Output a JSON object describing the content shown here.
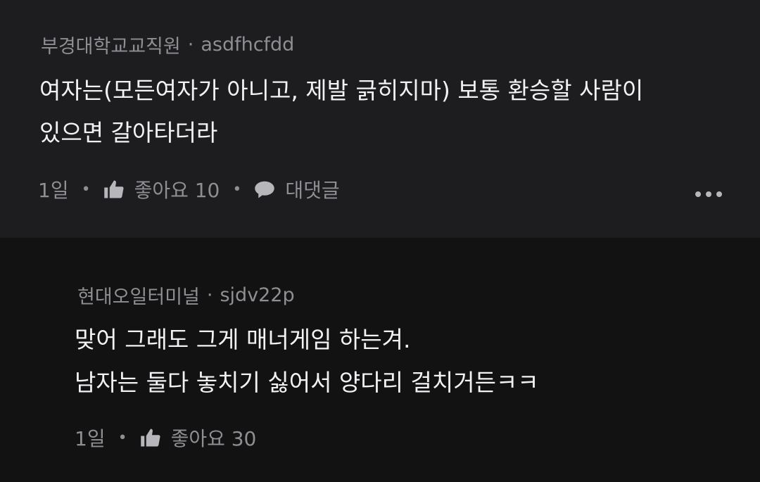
{
  "comments": [
    {
      "channel": "부경대학교교직원",
      "separator": "·",
      "username": "asdfhcfdd",
      "lines": [
        "여자는(모든여자가 아니고, 제발 긁히지마) 보통 환승할 사람이",
        "있으면 갈아타더라"
      ],
      "time": "1일",
      "like_label": "좋아요 10",
      "reply_label": "대댓글",
      "icons": [
        "thumbs-up-icon",
        "speech-bubble-icon",
        "more-icon"
      ]
    },
    {
      "channel": "현대오일터미널",
      "separator": "·",
      "username": "sjdv22p",
      "lines": [
        "맞어 그래도 그게 매너게임 하는겨.",
        "남자는 둘다 놓치기 싫어서 양다리 걸치거든ㅋㅋ"
      ],
      "time": "1일",
      "like_label": "좋아요 30",
      "icons": [
        "thumbs-up-icon"
      ]
    }
  ],
  "colors": {
    "background": "#1d1d1f",
    "reply_background": "#121213",
    "text": "#f2f2f4",
    "muted": "#8e8e93"
  }
}
